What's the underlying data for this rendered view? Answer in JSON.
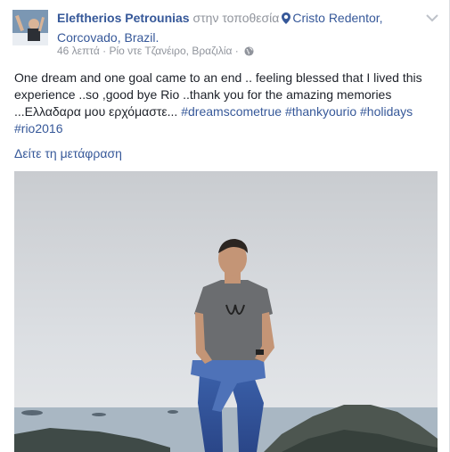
{
  "post": {
    "author": "Eleftherios Petrounias",
    "at_text": "στην τοποθεσία",
    "location": "Cristo Redentor, Corcovado, Brazil.",
    "meta_time": "46 λεπτά",
    "meta_separator": " · ",
    "meta_place": "Ρίο ντε Τζανέιρο, Βραζιλία",
    "meta_separator2": " · ",
    "text_main": "One dream and one goal came to an end .. feeling blessed that I lived this experience ..so ,good bye Rio ..thank you for the amazing memories ...Ελλαδαρα μου ερχόμαστε... ",
    "hashtags": [
      "#dreamscometrue",
      "#thankyourio",
      "#holidays",
      "#rio2016"
    ],
    "translate_link": "Δείτε τη μετάφραση"
  },
  "icons": {
    "location": "map-pin-icon",
    "privacy": "globe-icon",
    "options": "chevron-down-icon"
  },
  "colors": {
    "link": "#365899",
    "meta": "#90949c",
    "text": "#1d2129"
  }
}
